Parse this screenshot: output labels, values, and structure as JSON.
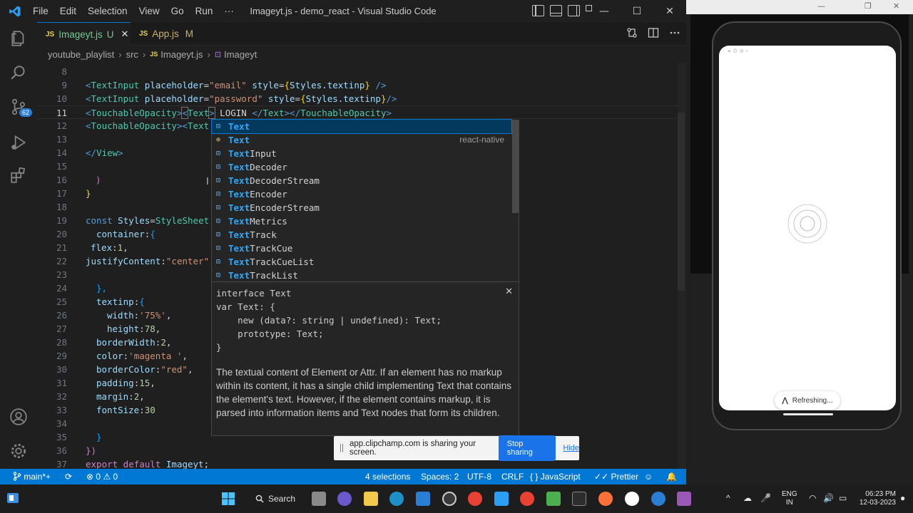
{
  "window": {
    "title": "Imageyt.js - demo_react - Visual Studio Code",
    "menus": [
      "File",
      "Edit",
      "Selection",
      "View",
      "Go",
      "Run",
      "···"
    ],
    "controls": {
      "minimize": "—",
      "maximize": "☐",
      "close": "✕"
    }
  },
  "activity": {
    "scm_badge": "62"
  },
  "tabs": [
    {
      "icon": "JS",
      "name": "Imageyt.js",
      "status": "U",
      "close": "✕"
    },
    {
      "icon": "JS",
      "name": "App.js",
      "status": "M"
    }
  ],
  "breadcrumb": {
    "parts": [
      "youtube_playlist",
      "src",
      "Imageyt.js",
      "Imageyt"
    ],
    "file_icon": "JS",
    "separator": "›"
  },
  "editor": {
    "line_numbers": [
      "8",
      "9",
      "10",
      "11",
      "12",
      "13",
      "14",
      "15",
      "16",
      "17",
      "18",
      "19",
      "20",
      "21",
      "22",
      "23",
      "24",
      "25",
      "26",
      "27",
      "28",
      "29",
      "30",
      "31",
      "32",
      "33",
      "34",
      "35",
      "36",
      "37"
    ],
    "cursor_line": "11",
    "code": {
      "l9": [
        "<",
        "TextInput",
        " placeholder",
        "=",
        "\"email\"",
        " style",
        "=",
        "{",
        "Styles.textinp",
        "}",
        " />"
      ],
      "l10": [
        "<",
        "TextInput",
        " placeholder",
        "=",
        "\"password\"",
        " style",
        "=",
        "{",
        "Styles.textinp",
        "}",
        "/>"
      ],
      "l11": [
        "<",
        "TouchableOpacity",
        ">",
        "<",
        "Text",
        ">",
        " LOGIN ",
        "</",
        "Text",
        "></",
        "TouchableOpacity",
        ">"
      ],
      "l12": [
        "<",
        "TouchableOpacity",
        ">",
        "<",
        "Text"
      ],
      "l14": [
        "</",
        "View",
        ">"
      ],
      "l16": ")",
      "l17": "}",
      "l19": [
        "const",
        " Styles",
        "=",
        "StyleSheet"
      ],
      "l20": [
        "container",
        ":",
        "{"
      ],
      "l21": [
        "flex",
        ":",
        "1",
        ","
      ],
      "l22": [
        "justifyContent",
        ":",
        "\"center\""
      ],
      "l24": "},",
      "l25": [
        "textinp",
        ":",
        "{"
      ],
      "l26": [
        "width",
        ":",
        "'75%'",
        ","
      ],
      "l27": [
        "height",
        ":",
        "78",
        ","
      ],
      "l28": [
        "borderWidth",
        ":",
        "2",
        ","
      ],
      "l29": [
        "color",
        ":",
        "'magenta '",
        ","
      ],
      "l30": [
        "borderColor",
        ":",
        "\"red\"",
        ","
      ],
      "l31": [
        "padding",
        ":",
        "15",
        ","
      ],
      "l32": [
        "margin",
        ":",
        "2",
        ","
      ],
      "l33": [
        "fontSize",
        ":",
        "30"
      ],
      "l35": "}",
      "l36": "})",
      "l37": [
        "export",
        " default",
        " Imageyt",
        ";"
      ]
    }
  },
  "suggest": {
    "items": [
      {
        "hl": "Text",
        "rest": "",
        "icon": "⊡",
        "selected": true,
        "detail": ""
      },
      {
        "hl": "Text",
        "rest": "",
        "icon": "⊕",
        "selected": false,
        "detail": "react-native"
      },
      {
        "hl": "Text",
        "rest": "Input",
        "icon": "⊡",
        "selected": false,
        "detail": ""
      },
      {
        "hl": "Text",
        "rest": "Decoder",
        "icon": "⊡",
        "selected": false,
        "detail": ""
      },
      {
        "hl": "Text",
        "rest": "DecoderStream",
        "icon": "⊡",
        "selected": false,
        "detail": ""
      },
      {
        "hl": "Text",
        "rest": "Encoder",
        "icon": "⊡",
        "selected": false,
        "detail": ""
      },
      {
        "hl": "Text",
        "rest": "EncoderStream",
        "icon": "⊡",
        "selected": false,
        "detail": ""
      },
      {
        "hl": "Text",
        "rest": "Metrics",
        "icon": "⊡",
        "selected": false,
        "detail": ""
      },
      {
        "hl": "Text",
        "rest": "Track",
        "icon": "⊡",
        "selected": false,
        "detail": ""
      },
      {
        "hl": "Text",
        "rest": "TrackCue",
        "icon": "⊡",
        "selected": false,
        "detail": ""
      },
      {
        "hl": "Text",
        "rest": "TrackCueList",
        "icon": "⊡",
        "selected": false,
        "detail": ""
      },
      {
        "hl": "Text",
        "rest": "TrackList",
        "icon": "⊡",
        "selected": false,
        "detail": ""
      }
    ],
    "details": {
      "signature": "interface Text\nvar Text: {\n    new (data?: string | undefined): Text;\n    prototype: Text;\n}",
      "doc": "The textual content of Element or Attr. If an element has no markup within its content, it has a single child implementing Text that contains the element's text. However, if the element contains markup, it is parsed into information items and Text nodes that form its children.",
      "close": "✕"
    }
  },
  "sharing": {
    "grip": "||",
    "message": "app.clipchamp.com is sharing your screen.",
    "stop_label": "Stop sharing",
    "hide_label": "Hide"
  },
  "statusbar": {
    "branch": "main*+",
    "errors": "0",
    "warnings": "0",
    "selections": "4 selections",
    "spaces": "Spaces: 2",
    "encoding": "UTF-8",
    "eol": "CRLF",
    "language_prefix": "{ }",
    "language": "JavaScript",
    "formatter_prefix": "✓✓",
    "formatter": "Prettier"
  },
  "phone": {
    "toast": "Refreshing..."
  },
  "taskbar": {
    "search_label": "Search",
    "lang_top": "ENG",
    "lang_bottom": "IN",
    "time": "06:23 PM",
    "date": "12-03-2023",
    "tray_chevron": "^"
  }
}
